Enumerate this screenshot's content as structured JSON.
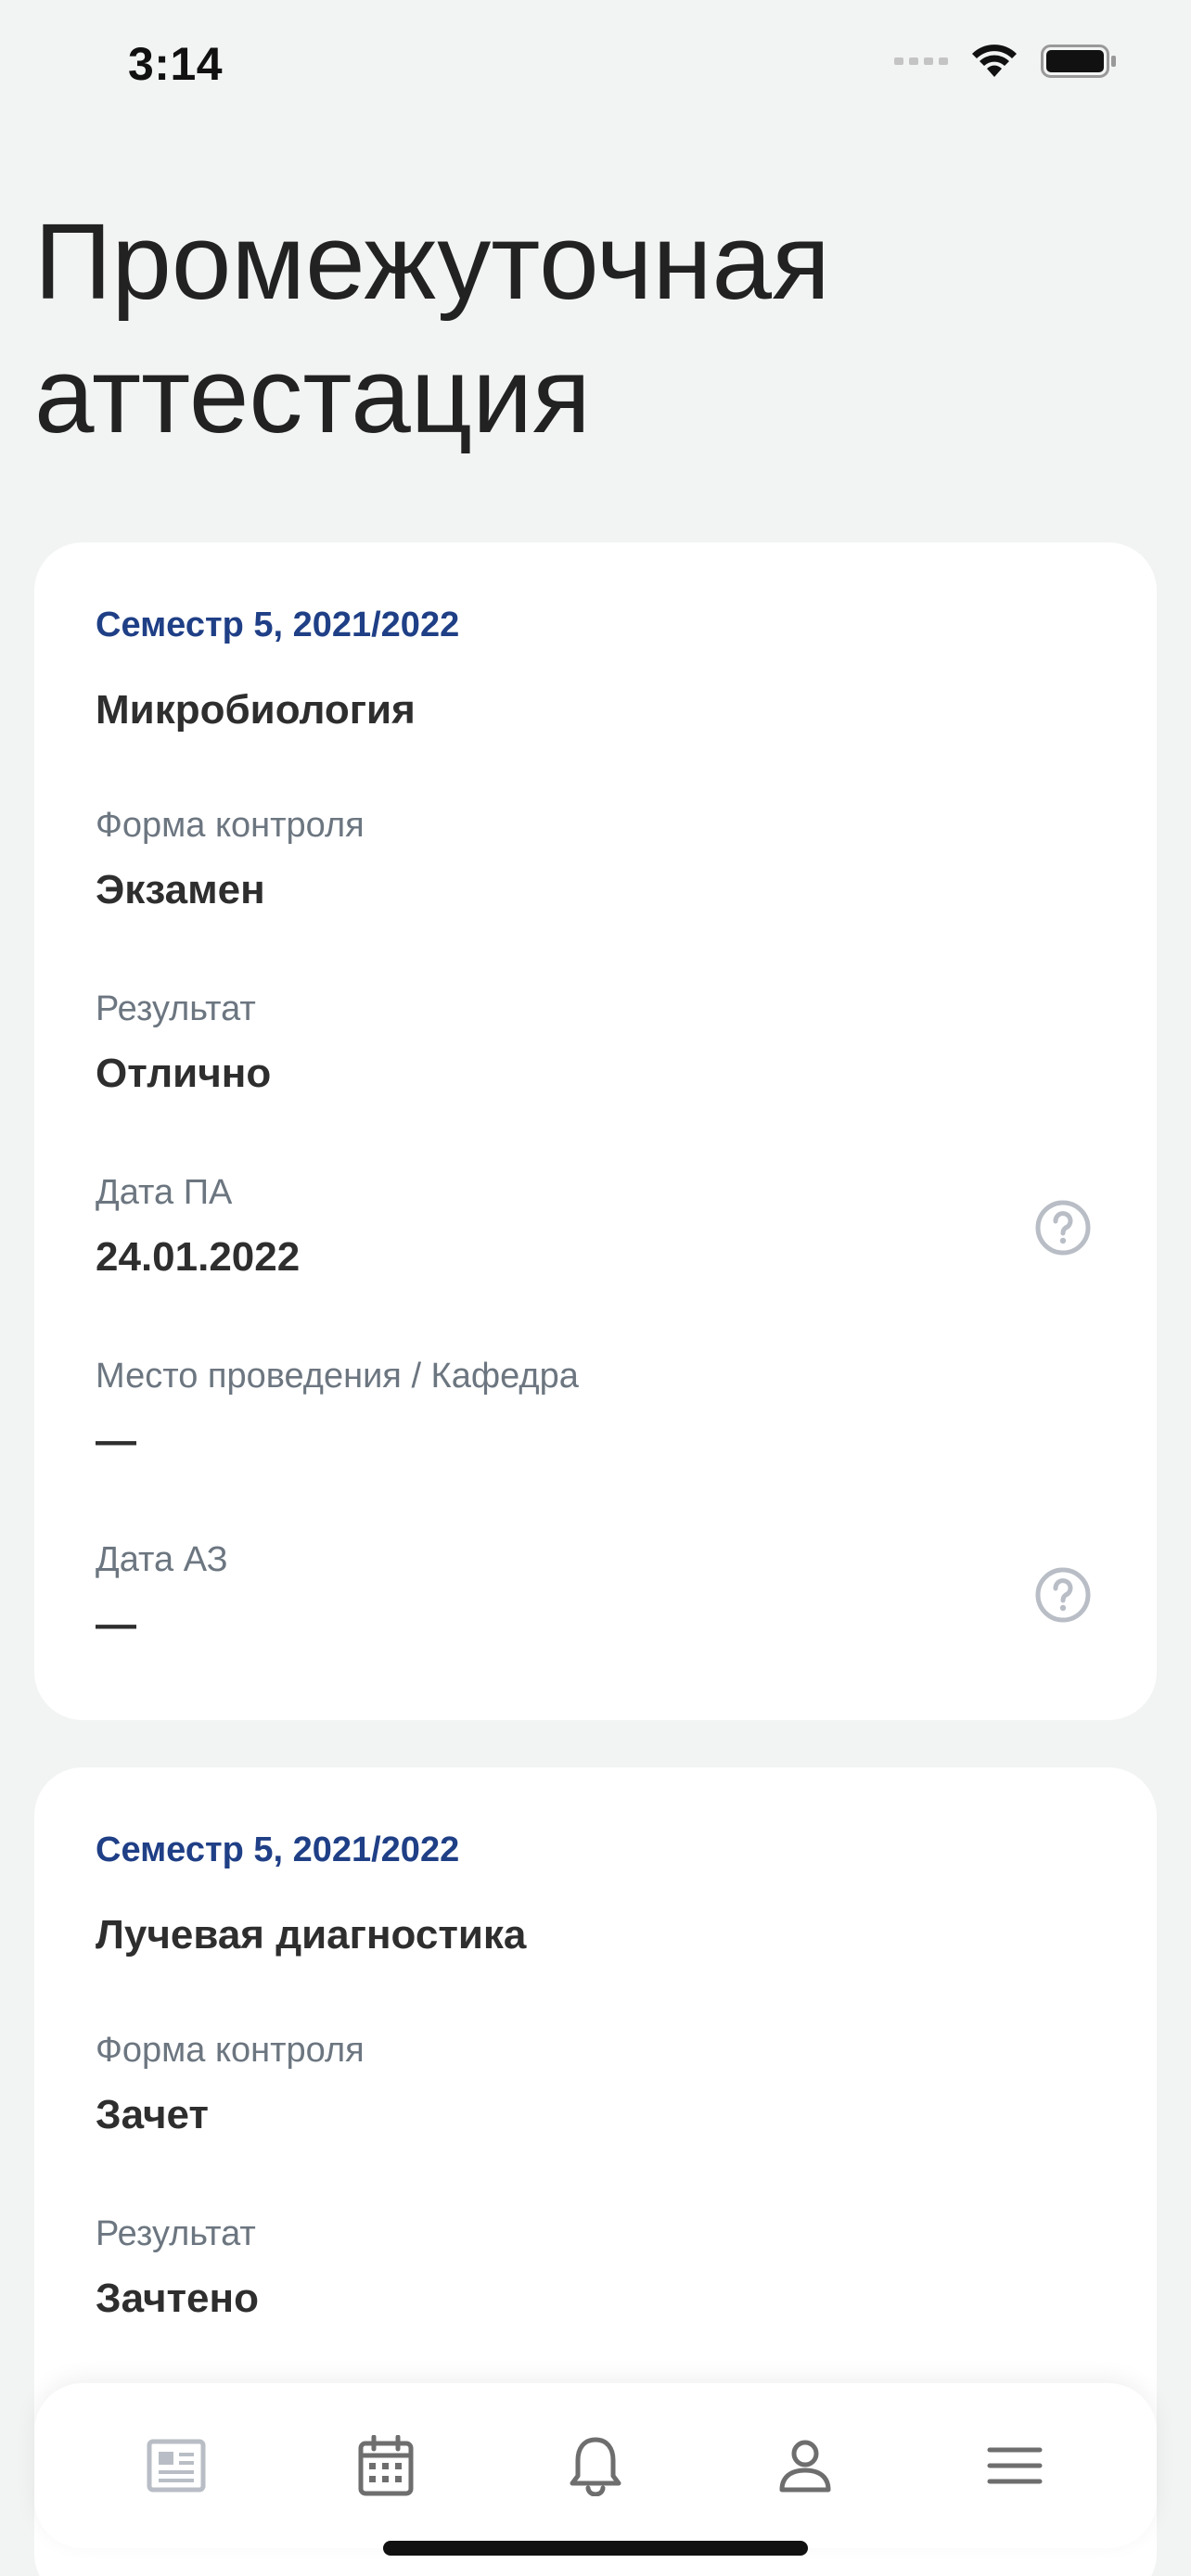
{
  "status_bar": {
    "time": "3:14",
    "icons": [
      "signal-icon",
      "wifi-icon",
      "battery-icon"
    ]
  },
  "header": {
    "title": "Промежуточная аттестация"
  },
  "cards": [
    {
      "semester": "Семестр 5, 2021/2022",
      "subject": "Микробиология",
      "fields": [
        {
          "label": "Форма контроля",
          "value": "Экзамен"
        },
        {
          "label": "Результат",
          "value": "Отлично"
        },
        {
          "label": "Дата ПА",
          "value": "24.01.2022",
          "help_icon": "question-circle-icon"
        },
        {
          "label": "Место проведения / Кафедра",
          "value": "—"
        },
        {
          "label": "Дата АЗ",
          "value": "—",
          "help_icon": "question-circle-icon"
        }
      ]
    },
    {
      "semester": "Семестр 5, 2021/2022",
      "subject": "Лучевая диагностика",
      "fields": [
        {
          "label": "Форма контроля",
          "value": "Зачет"
        },
        {
          "label": "Результат",
          "value": "Зачтено"
        }
      ]
    }
  ],
  "tab_bar": {
    "items": [
      {
        "icon": "news-icon",
        "active": false
      },
      {
        "icon": "calendar-icon",
        "active": false
      },
      {
        "icon": "bell-icon",
        "active": false
      },
      {
        "icon": "profile-icon",
        "active": false
      },
      {
        "icon": "menu-icon",
        "active": false
      }
    ]
  },
  "colors": {
    "background": "#f2f3f3",
    "card": "#ffffff",
    "semester_accent": "#1f3f86",
    "label": "#6c7680",
    "value": "#2e2e2e",
    "icon": "#6e6e6e",
    "icon_muted": "#b9bec6"
  }
}
